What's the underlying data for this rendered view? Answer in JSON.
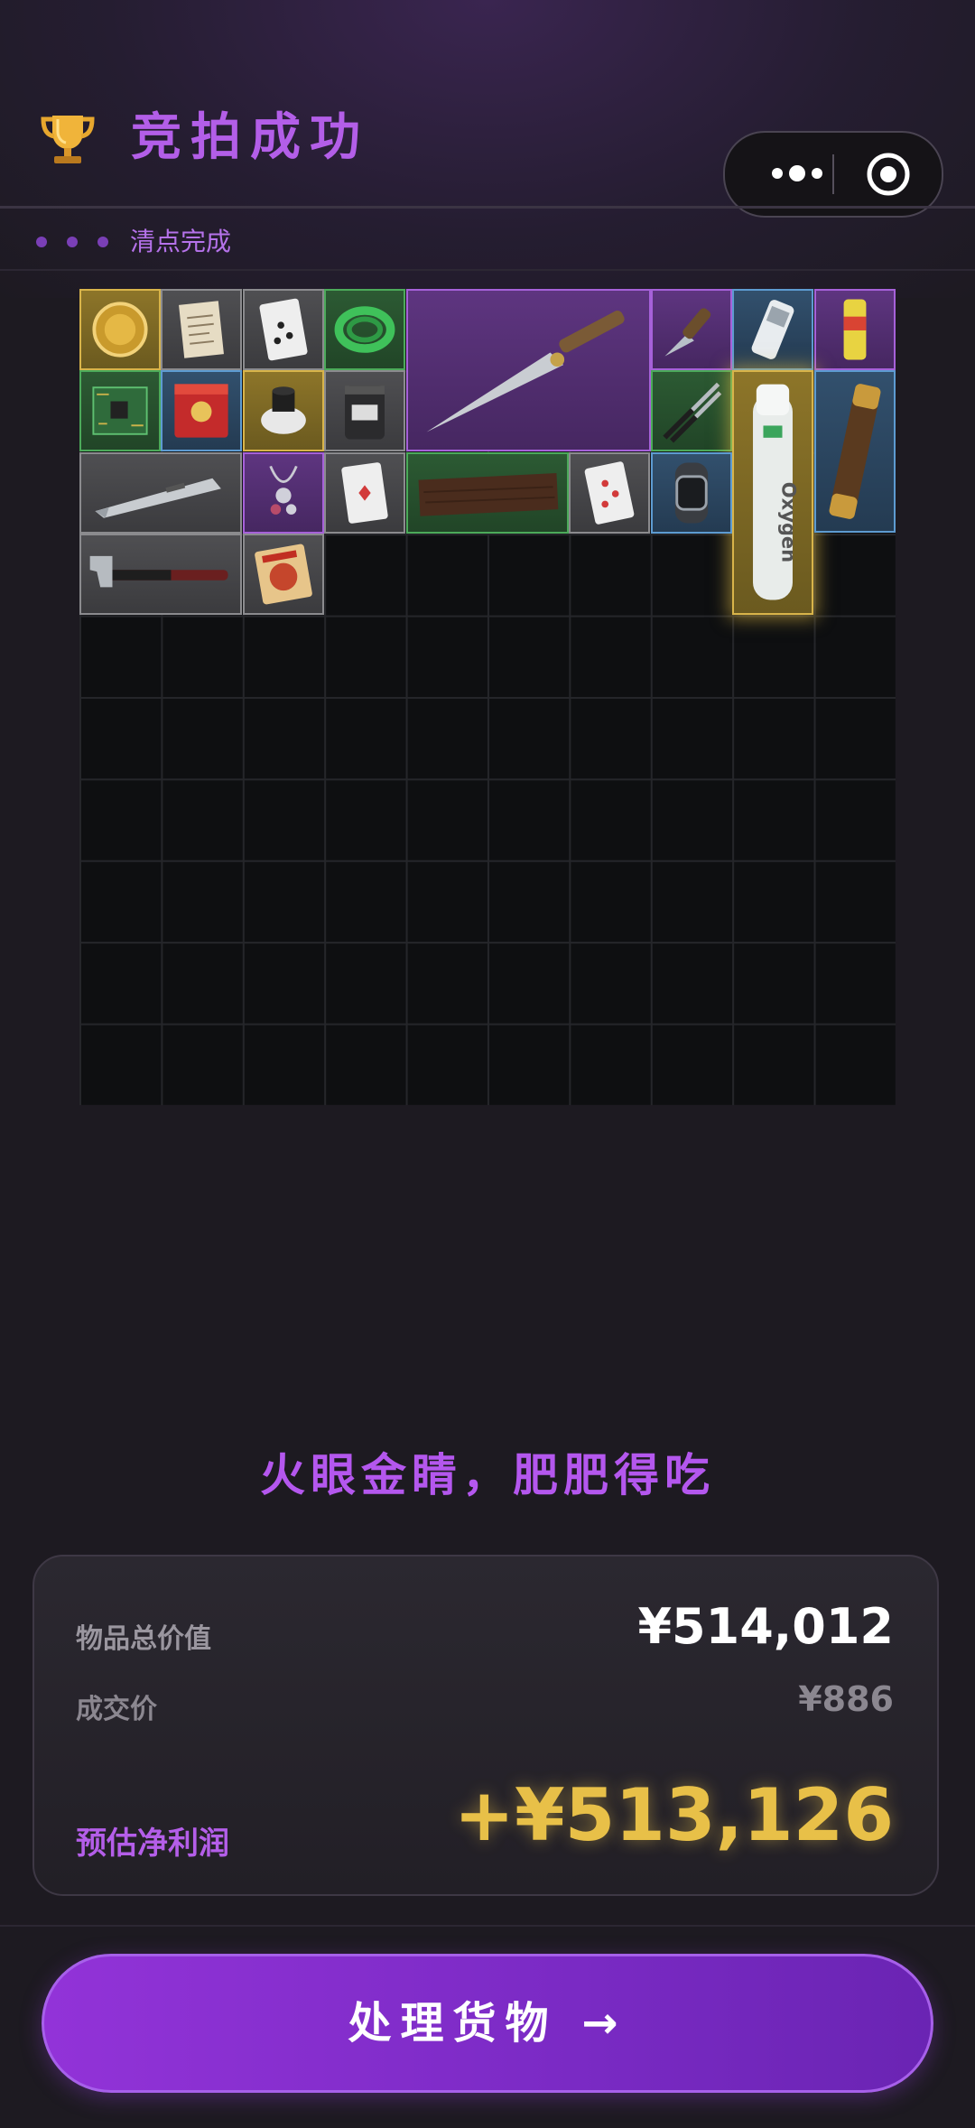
{
  "header": {
    "title": "竞拍成功",
    "trophy_icon": "trophy-icon",
    "menu_icon": "more-dots-icon",
    "close_icon": "target-circle-icon"
  },
  "progress": {
    "label": "清点完成",
    "dots": 3,
    "dot_color": "#7a3fb6"
  },
  "inventory": {
    "grid_columns": 10,
    "grid_rows": 10,
    "items": [
      {
        "name": "gold-medallion",
        "rarity": "gold"
      },
      {
        "name": "paper-document",
        "rarity": "gray"
      },
      {
        "name": "playing-card-spades",
        "rarity": "gray"
      },
      {
        "name": "green-cable-coil",
        "rarity": "green"
      },
      {
        "name": "combat-knife",
        "rarity": "purple"
      },
      {
        "name": "folding-knife",
        "rarity": "purple"
      },
      {
        "name": "mp3-player",
        "rarity": "blue"
      },
      {
        "name": "energy-can",
        "rarity": "purple"
      },
      {
        "name": "circuit-board",
        "rarity": "green"
      },
      {
        "name": "red-tin-box",
        "rarity": "blue"
      },
      {
        "name": "gas-filter",
        "rarity": "gold"
      },
      {
        "name": "protein-jar",
        "rarity": "gray"
      },
      {
        "name": "pliers",
        "rarity": "green"
      },
      {
        "name": "oxygen-tank",
        "rarity": "gold",
        "label": "Oxygen"
      },
      {
        "name": "brass-telescope",
        "rarity": "blue"
      },
      {
        "name": "utility-knife",
        "rarity": "gray"
      },
      {
        "name": "silver-necklace",
        "rarity": "purple"
      },
      {
        "name": "playing-card-diamonds",
        "rarity": "gray"
      },
      {
        "name": "wooden-plank",
        "rarity": "green"
      },
      {
        "name": "playing-card-hearts",
        "rarity": "gray"
      },
      {
        "name": "smart-watch",
        "rarity": "blue"
      },
      {
        "name": "hammer",
        "rarity": "gray"
      },
      {
        "name": "noodle-pack",
        "rarity": "gray"
      }
    ],
    "colors": {
      "gold": "#d8b44a",
      "gray": "#8b8b8e",
      "green": "#4caa5a",
      "purple": "#a661d9",
      "blue": "#5d9bd1"
    }
  },
  "slogan": "火眼金睛，肥肥得吃",
  "summary": {
    "total_value_label": "物品总价值",
    "total_value": "¥514,012",
    "deal_price_label": "成交价",
    "deal_price": "¥886",
    "profit_label": "预估净利润",
    "profit": "+¥513,126",
    "profit_color": "#e8c048"
  },
  "cta": {
    "label": "处理货物 →"
  }
}
